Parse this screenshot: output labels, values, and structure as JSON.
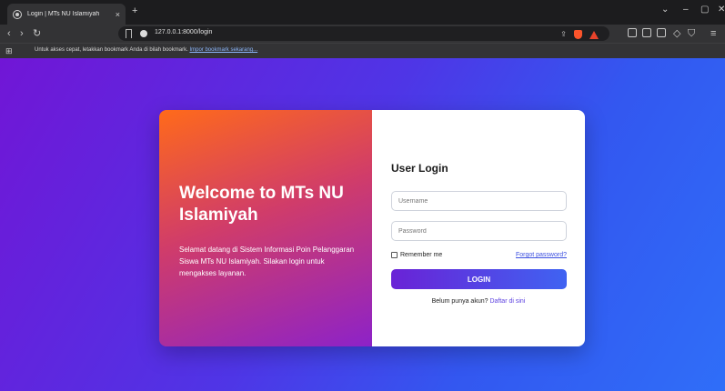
{
  "browser": {
    "tab_title": "Login | MTs NU Islamiyah",
    "tab_close": "×",
    "new_tab": "+",
    "url": "127.0.0.1:8000/login",
    "bookmarks_message": "Untuk akses cepat, letakkan bookmark Anda di bilah bookmark.",
    "bookmarks_link": "Impor bookmark sekarang...",
    "accent_brave": "#fb542b"
  },
  "card": {
    "welcome_title": "Welcome to MTs NU Islamiyah",
    "welcome_text": "Selamat datang di Sistem Informasi Poin Pelanggaran Siswa MTs NU Islamiyah. Silakan login untuk mengakses layanan.",
    "form_title": "User Login",
    "username_placeholder": "Username",
    "password_placeholder": "Password",
    "remember_label": "Remember me",
    "forgot_label": "Forgot password?",
    "login_label": "LOGIN",
    "register_prompt": "Belum punya akun?",
    "register_link": "Daftar di sini"
  },
  "colors": {
    "page_gradient_start": "#7116d6",
    "page_gradient_end": "#2f6ef8",
    "panel_gradient_top": "#ff6a1a",
    "panel_gradient_bottom": "#8d22c8",
    "button_start": "#6a22d6",
    "button_end": "#3f63f2",
    "link_color": "#3b4fe0"
  }
}
